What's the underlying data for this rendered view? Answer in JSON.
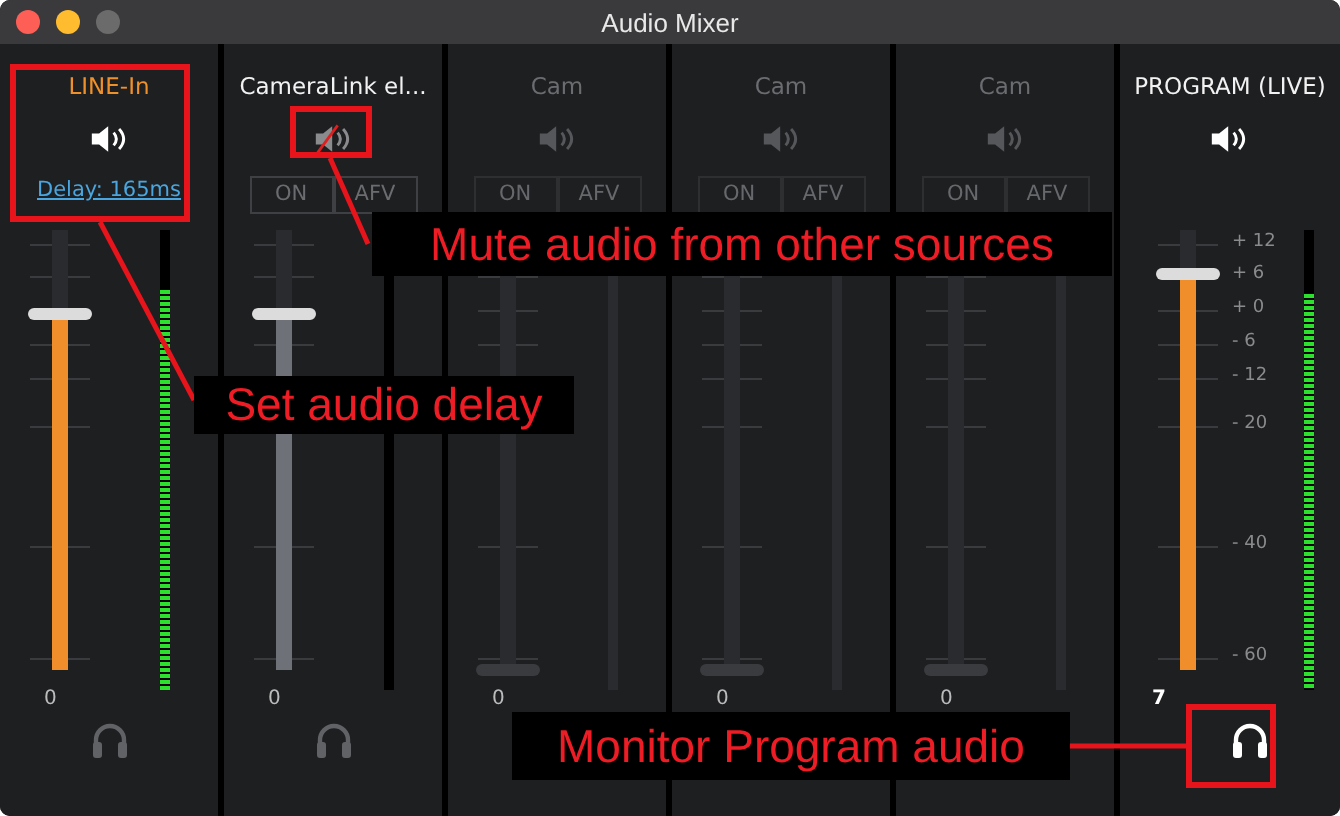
{
  "window": {
    "title": "Audio Mixer"
  },
  "channels": [
    {
      "kind": "source",
      "name": "LINE-In",
      "selected": true,
      "disabled": false,
      "muted": false,
      "delay": "Delay: 165ms",
      "level": 0.81,
      "reading": "0",
      "meter": {
        "level": 0.87
      },
      "monitor": false
    },
    {
      "kind": "source",
      "name": "CameraLink el...",
      "selected": false,
      "disabled": false,
      "muted": true,
      "buttons": [
        {
          "label": "ON",
          "selected": false
        },
        {
          "label": "AFV",
          "selected": false
        }
      ],
      "level": 0.81,
      "reading": "0",
      "monitor": false
    },
    {
      "kind": "source",
      "name": "Cam",
      "selected": false,
      "disabled": true,
      "muted": false,
      "buttons": [
        {
          "label": "ON",
          "selected": false
        },
        {
          "label": "AFV",
          "selected": false
        }
      ],
      "level": 0,
      "reading": "0"
    },
    {
      "kind": "source",
      "name": "Cam",
      "selected": false,
      "disabled": true,
      "muted": false,
      "buttons": [
        {
          "label": "ON",
          "selected": false
        },
        {
          "label": "AFV",
          "selected": false
        }
      ],
      "level": 0,
      "reading": "0"
    },
    {
      "kind": "source",
      "name": "Cam",
      "selected": false,
      "disabled": true,
      "muted": false,
      "buttons": [
        {
          "label": "ON",
          "selected": false
        },
        {
          "label": "AFV",
          "selected": false
        }
      ],
      "level": 0,
      "reading": "0"
    },
    {
      "kind": "program",
      "name": "PROGRAM (LIVE)",
      "selected": false,
      "disabled": false,
      "muted": false,
      "scale": [
        "+ 12",
        "+ 6",
        "+ 0",
        "- 6",
        "- 12",
        "- 20",
        "- 40",
        "- 60"
      ],
      "level": 0.9,
      "reading": "7",
      "meter": {
        "level": 0.86
      },
      "monitor": true
    }
  ],
  "annotations": [
    {
      "text": "Set audio delay"
    },
    {
      "text": "Mute audio from other sources"
    },
    {
      "text": "Monitor Program audio"
    }
  ]
}
